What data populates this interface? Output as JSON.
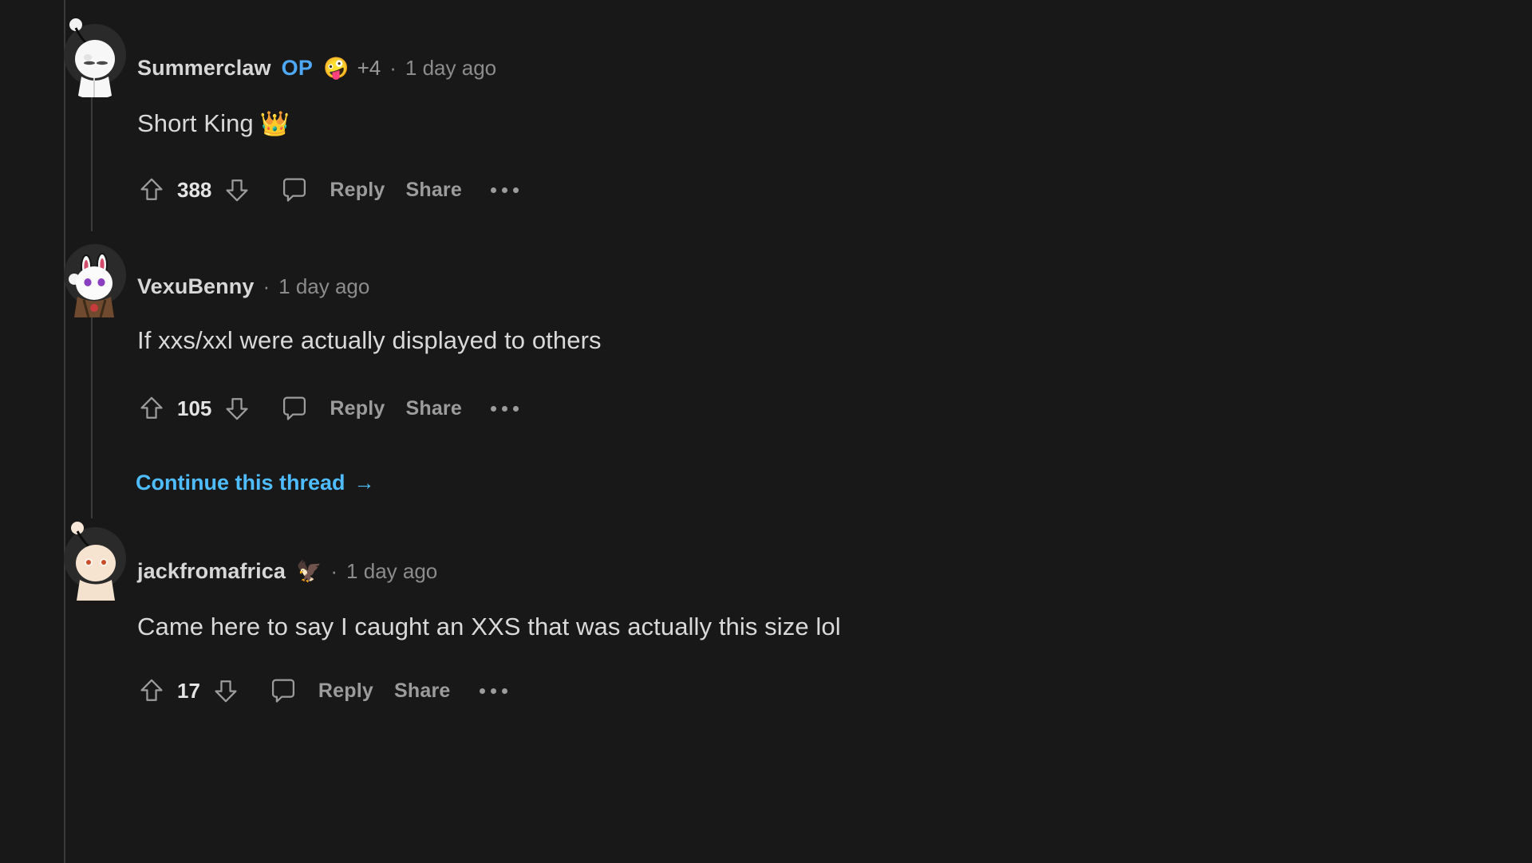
{
  "app": {
    "name": "reddit-comments",
    "theme": "dark",
    "background": "#181818"
  },
  "colors": {
    "background": "#181818",
    "text_primary": "#d9d9d9",
    "text_muted": "#8c8c8c",
    "op_tag": "#4fa8f5",
    "link": "#4fbcff",
    "thread_line": "#3b3b3b"
  },
  "action_labels": {
    "reply": "Reply",
    "share": "Share",
    "more": "more-options"
  },
  "comments": [
    {
      "id": "c1",
      "author": "Summerclaw",
      "op_tag": "OP",
      "award_icon": "award-badge-icon",
      "award_emoji": "🤪",
      "award_count": "+4",
      "separator": "·",
      "timestamp": "1 day ago",
      "body": "Short King",
      "body_emoji": "👑",
      "score": "388",
      "reply": "Reply",
      "share": "Share",
      "avatar": "snoo-avatar-white"
    },
    {
      "id": "c2",
      "author": "VexuBenny",
      "op_tag": "",
      "award_emoji": "",
      "award_count": "",
      "separator": "·",
      "timestamp": "1 day ago",
      "body": "If xxs/xxl were actually displayed to others",
      "body_emoji": "",
      "score": "105",
      "reply": "Reply",
      "share": "Share",
      "avatar": "snoo-avatar-bunny",
      "continue_thread": "Continue this thread",
      "continue_arrow": "→"
    },
    {
      "id": "c3",
      "author": "jackfromafrica",
      "op_tag": "",
      "award_emoji": "🦅",
      "award_count": "",
      "separator": "·",
      "timestamp": "1 day ago",
      "body": "Came here to say I caught an XXS that was actually this size lol",
      "body_emoji": "",
      "score": "17",
      "reply": "Reply",
      "share": "Share",
      "avatar": "snoo-avatar-cream"
    }
  ]
}
